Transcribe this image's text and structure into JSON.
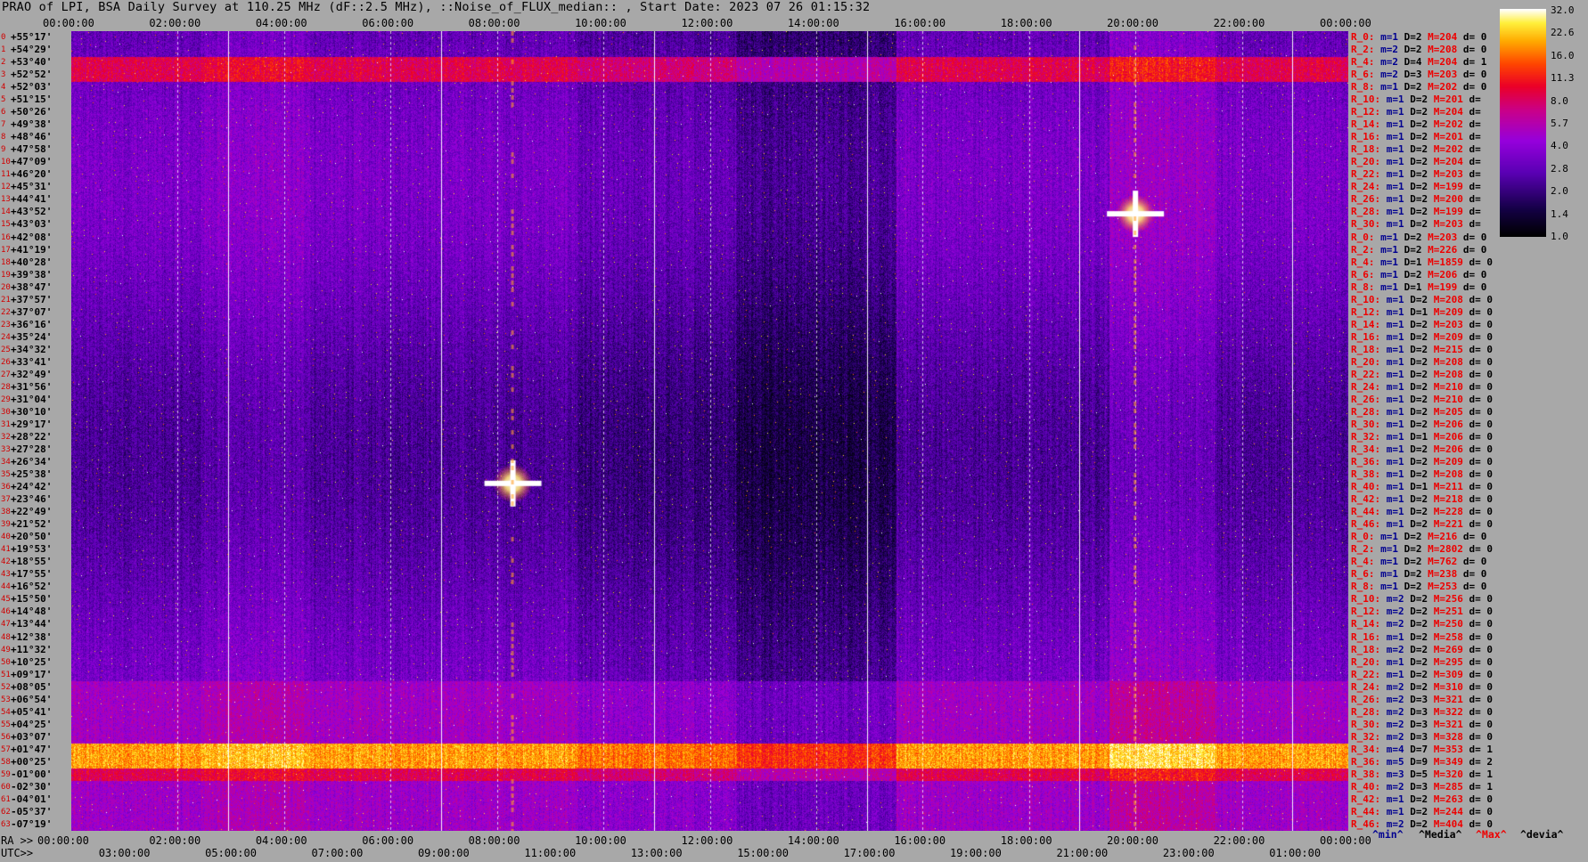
{
  "title": "PRAO of LPI, BSA Daily Survey at 110.25 MHz (dF::2.5 MHz), ::Noise_of_FLUX_median:: , Start Date: 2023 07 26 01:15:32",
  "colors": {
    "background": "#a8a8a8",
    "row_prefix": "#ee0000",
    "row_stats": "#000090"
  },
  "chart_data": {
    "type": "heatmap",
    "colormap": "black-purple-red-orange-yellow-white",
    "colorbar_ticks": [
      "32.0",
      "22.6",
      "16.0",
      "11.3",
      "8.0",
      "5.7",
      "4.0",
      "2.8",
      "2.0",
      "1.4",
      "1.0"
    ],
    "x_top_ticks": [
      "00:00:00",
      "02:00:00",
      "04:00:00",
      "06:00:00",
      "08:00:00",
      "10:00:00",
      "12:00:00",
      "14:00:00",
      "16:00:00",
      "18:00:00",
      "20:00:00",
      "22:00:00",
      "00:00:00"
    ],
    "x_bottom_ra_prefix": "RA >>",
    "x_bottom_ra_ticks": [
      "00:00:00",
      "02:00:00",
      "04:00:00",
      "06:00:00",
      "08:00:00",
      "10:00:00",
      "12:00:00",
      "14:00:00",
      "16:00:00",
      "18:00:00",
      "20:00:00",
      "22:00:00",
      "00:00:00"
    ],
    "x_bottom_utc_prefix": "UTC>>",
    "x_bottom_utc_ticks": [
      "03:00:00",
      "05:00:00",
      "07:00:00",
      "09:00:00",
      "11:00:00",
      "13:00:00",
      "15:00:00",
      "17:00:00",
      "19:00:00",
      "21:00:00",
      "23:00:00",
      "01:00:00"
    ],
    "dec_labels": [
      "+55°17'",
      "+54°29'",
      "+53°40'",
      "+52°52'",
      "+52°03'",
      "+51°15'",
      "+50°26'",
      "+49°38'",
      "+48°46'",
      "+47°58'",
      "+47°09'",
      "+46°20'",
      "+45°31'",
      "+44°41'",
      "+43°52'",
      "+43°03'",
      "+42°08'",
      "+41°19'",
      "+40°28'",
      "+39°38'",
      "+38°47'",
      "+37°57'",
      "+37°07'",
      "+36°16'",
      "+35°24'",
      "+34°32'",
      "+33°41'",
      "+32°49'",
      "+31°56'",
      "+31°04'",
      "+30°10'",
      "+29°17'",
      "+28°22'",
      "+27°28'",
      "+26°34'",
      "+25°38'",
      "+24°42'",
      "+23°46'",
      "+22°49'",
      "+21°52'",
      "+20°50'",
      "+19°53'",
      "+18°55'",
      "+17°55'",
      "+16°52'",
      "+15°50'",
      "+14°48'",
      "+13°44'",
      "+12°38'",
      "+11°32'",
      "+10°25'",
      "+09°17'",
      "+08°05'",
      "+06°54'",
      "+05°41'",
      "+04°25'",
      "+03°07'",
      "+01°47'",
      "+00°25'",
      "-01°00'",
      "-02°30'",
      "-04°01'",
      "-05°37'",
      "-07°19'"
    ],
    "rows": [
      {
        "r": "R_0:",
        "m": "1",
        "D": "2",
        "M": "204",
        "d": "0"
      },
      {
        "r": "R_2:",
        "m": "2",
        "D": "2",
        "M": "208",
        "d": "0"
      },
      {
        "r": "R_4:",
        "m": "2",
        "D": "4",
        "M": "204",
        "d": "1"
      },
      {
        "r": "R_6:",
        "m": "2",
        "D": "3",
        "M": "203",
        "d": "0"
      },
      {
        "r": "R_8:",
        "m": "1",
        "D": "2",
        "M": "202",
        "d": "0"
      },
      {
        "r": "R_10:",
        "m": "1",
        "D": "2",
        "M": "201",
        "d": ""
      },
      {
        "r": "R_12:",
        "m": "1",
        "D": "2",
        "M": "204",
        "d": ""
      },
      {
        "r": "R_14:",
        "m": "1",
        "D": "2",
        "M": "202",
        "d": ""
      },
      {
        "r": "R_16:",
        "m": "1",
        "D": "2",
        "M": "201",
        "d": ""
      },
      {
        "r": "R_18:",
        "m": "1",
        "D": "2",
        "M": "202",
        "d": ""
      },
      {
        "r": "R_20:",
        "m": "1",
        "D": "2",
        "M": "204",
        "d": ""
      },
      {
        "r": "R_22:",
        "m": "1",
        "D": "2",
        "M": "203",
        "d": ""
      },
      {
        "r": "R_24:",
        "m": "1",
        "D": "2",
        "M": "199",
        "d": ""
      },
      {
        "r": "R_26:",
        "m": "1",
        "D": "2",
        "M": "200",
        "d": ""
      },
      {
        "r": "R_28:",
        "m": "1",
        "D": "2",
        "M": "199",
        "d": ""
      },
      {
        "r": "R_30:",
        "m": "1",
        "D": "2",
        "M": "203",
        "d": ""
      },
      {
        "r": "R_0:",
        "m": "1",
        "D": "2",
        "M": "203",
        "d": "0"
      },
      {
        "r": "R_2:",
        "m": "1",
        "D": "2",
        "M": "226",
        "d": "0"
      },
      {
        "r": "R_4:",
        "m": "1",
        "D": "1",
        "M": "1859",
        "d": "0"
      },
      {
        "r": "R_6:",
        "m": "1",
        "D": "2",
        "M": "206",
        "d": "0"
      },
      {
        "r": "R_8:",
        "m": "1",
        "D": "1",
        "M": "199",
        "d": "0"
      },
      {
        "r": "R_10:",
        "m": "1",
        "D": "2",
        "M": "208",
        "d": "0"
      },
      {
        "r": "R_12:",
        "m": "1",
        "D": "1",
        "M": "209",
        "d": "0"
      },
      {
        "r": "R_14:",
        "m": "1",
        "D": "2",
        "M": "203",
        "d": "0"
      },
      {
        "r": "R_16:",
        "m": "1",
        "D": "2",
        "M": "209",
        "d": "0"
      },
      {
        "r": "R_18:",
        "m": "1",
        "D": "2",
        "M": "215",
        "d": "0"
      },
      {
        "r": "R_20:",
        "m": "1",
        "D": "2",
        "M": "208",
        "d": "0"
      },
      {
        "r": "R_22:",
        "m": "1",
        "D": "2",
        "M": "208",
        "d": "0"
      },
      {
        "r": "R_24:",
        "m": "1",
        "D": "2",
        "M": "210",
        "d": "0"
      },
      {
        "r": "R_26:",
        "m": "1",
        "D": "2",
        "M": "210",
        "d": "0"
      },
      {
        "r": "R_28:",
        "m": "1",
        "D": "2",
        "M": "205",
        "d": "0"
      },
      {
        "r": "R_30:",
        "m": "1",
        "D": "2",
        "M": "206",
        "d": "0"
      },
      {
        "r": "R_32:",
        "m": "1",
        "D": "1",
        "M": "206",
        "d": "0"
      },
      {
        "r": "R_34:",
        "m": "1",
        "D": "2",
        "M": "206",
        "d": "0"
      },
      {
        "r": "R_36:",
        "m": "1",
        "D": "2",
        "M": "209",
        "d": "0"
      },
      {
        "r": "R_38:",
        "m": "1",
        "D": "2",
        "M": "208",
        "d": "0"
      },
      {
        "r": "R_40:",
        "m": "1",
        "D": "1",
        "M": "211",
        "d": "0"
      },
      {
        "r": "R_42:",
        "m": "1",
        "D": "2",
        "M": "218",
        "d": "0"
      },
      {
        "r": "R_44:",
        "m": "1",
        "D": "2",
        "M": "228",
        "d": "0"
      },
      {
        "r": "R_46:",
        "m": "1",
        "D": "2",
        "M": "221",
        "d": "0"
      },
      {
        "r": "R_0:",
        "m": "1",
        "D": "2",
        "M": "216",
        "d": "0"
      },
      {
        "r": "R_2:",
        "m": "1",
        "D": "2",
        "M": "2802",
        "d": "0"
      },
      {
        "r": "R_4:",
        "m": "1",
        "D": "2",
        "M": "762",
        "d": "0"
      },
      {
        "r": "R_6:",
        "m": "1",
        "D": "2",
        "M": "238",
        "d": "0"
      },
      {
        "r": "R_8:",
        "m": "1",
        "D": "2",
        "M": "253",
        "d": "0"
      },
      {
        "r": "R_10:",
        "m": "2",
        "D": "2",
        "M": "256",
        "d": "0"
      },
      {
        "r": "R_12:",
        "m": "2",
        "D": "2",
        "M": "251",
        "d": "0"
      },
      {
        "r": "R_14:",
        "m": "2",
        "D": "2",
        "M": "250",
        "d": "0"
      },
      {
        "r": "R_16:",
        "m": "1",
        "D": "2",
        "M": "258",
        "d": "0"
      },
      {
        "r": "R_18:",
        "m": "2",
        "D": "2",
        "M": "269",
        "d": "0"
      },
      {
        "r": "R_20:",
        "m": "1",
        "D": "2",
        "M": "295",
        "d": "0"
      },
      {
        "r": "R_22:",
        "m": "1",
        "D": "2",
        "M": "309",
        "d": "0"
      },
      {
        "r": "R_24:",
        "m": "2",
        "D": "2",
        "M": "310",
        "d": "0"
      },
      {
        "r": "R_26:",
        "m": "2",
        "D": "3",
        "M": "321",
        "d": "0"
      },
      {
        "r": "R_28:",
        "m": "2",
        "D": "3",
        "M": "322",
        "d": "0"
      },
      {
        "r": "R_30:",
        "m": "2",
        "D": "3",
        "M": "321",
        "d": "0"
      },
      {
        "r": "R_32:",
        "m": "2",
        "D": "3",
        "M": "328",
        "d": "0"
      },
      {
        "r": "R_34:",
        "m": "4",
        "D": "7",
        "M": "353",
        "d": "1"
      },
      {
        "r": "R_36:",
        "m": "5",
        "D": "9",
        "M": "349",
        "d": "2"
      },
      {
        "r": "R_38:",
        "m": "3",
        "D": "5",
        "M": "320",
        "d": "1"
      },
      {
        "r": "R_40:",
        "m": "2",
        "D": "3",
        "M": "285",
        "d": "1"
      },
      {
        "r": "R_42:",
        "m": "1",
        "D": "2",
        "M": "263",
        "d": "0"
      },
      {
        "r": "R_44:",
        "m": "1",
        "D": "2",
        "M": "244",
        "d": "0"
      },
      {
        "r": "R_46:",
        "m": "2",
        "D": "2",
        "M": "404",
        "d": "0"
      }
    ],
    "legend": [
      "^min^",
      "^Media^",
      "^Max^",
      "^devia^"
    ],
    "features": [
      {
        "type": "bright_source",
        "ra_h": 8.3,
        "dec_deg": 19.9
      },
      {
        "type": "bright_source",
        "ra_h": 20.0,
        "dec_deg": 41.0
      },
      {
        "type": "band",
        "dec_deg": 53.2
      },
      {
        "type": "band",
        "dec_deg": 0.5
      }
    ]
  }
}
